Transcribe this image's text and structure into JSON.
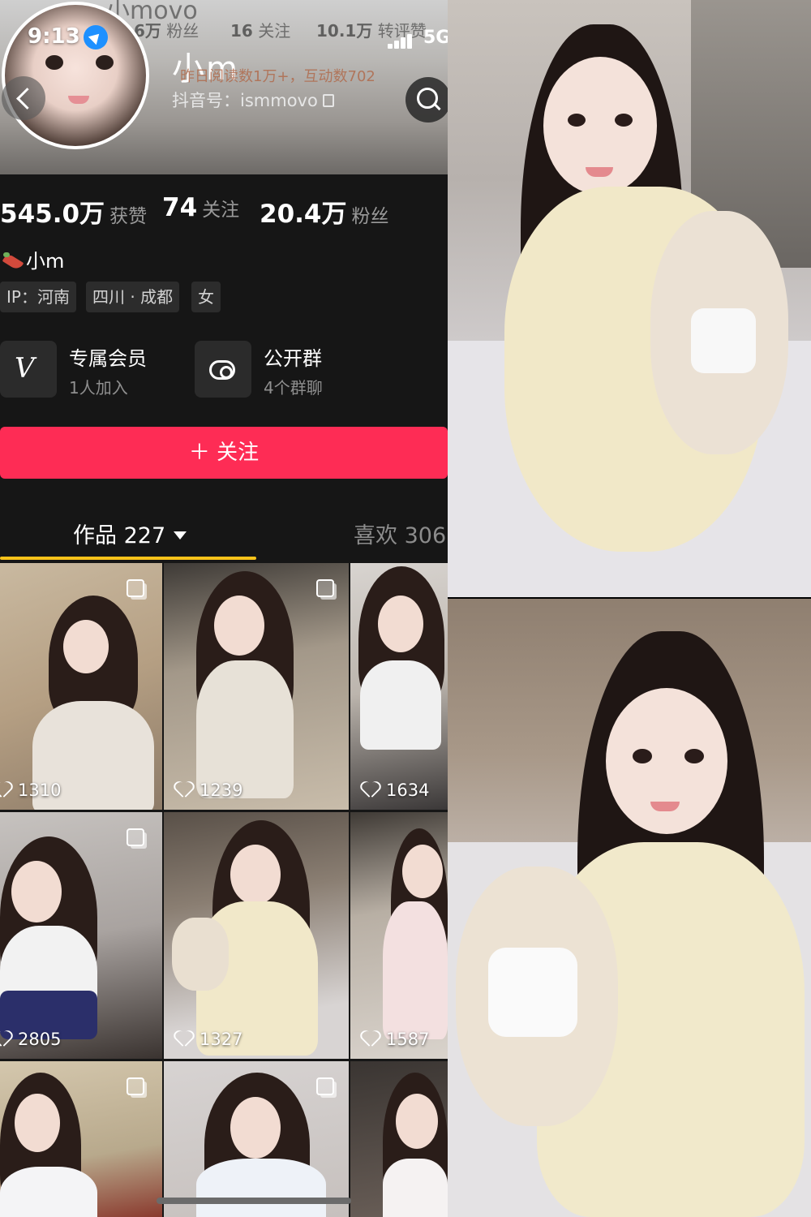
{
  "status_bar": {
    "time": "9:13",
    "network": "5G"
  },
  "header_faint": {
    "username_fragment": "小movo",
    "fans_num": "6万",
    "fans_label": "粉丝",
    "following_num": "16",
    "following_label": "关注",
    "likes_num": "10.1万",
    "likes_label": "转评赞"
  },
  "profile": {
    "display_name": "小m",
    "reads_line": "昨日阅读数1万+，互动数702",
    "douyin_id": "抖音号：ismmovo"
  },
  "stats": [
    {
      "num": "545.0万",
      "label": "获赞"
    },
    {
      "num": "74",
      "label": "关注"
    },
    {
      "num": "20.4万",
      "label": "粉丝"
    }
  ],
  "bio": "小m",
  "tags": [
    "IP：河南",
    "四川 · 成都",
    "女"
  ],
  "features": [
    {
      "title": "专属会员",
      "sub": "1人加入",
      "icon": "vip-v-icon"
    },
    {
      "title": "公开群",
      "sub": "4个群聊",
      "icon": "group-chat-icon"
    }
  ],
  "follow_button": "＋ 关注",
  "tabs": {
    "works": "作品 227",
    "likes": "喜欢 306"
  },
  "grid_likes": [
    "1310",
    "1239",
    "1634",
    "2805",
    "1327",
    "1587"
  ],
  "colors": {
    "accent_red": "#fe2c55",
    "tab_indicator": "#f9c31a",
    "background": "#161616"
  }
}
